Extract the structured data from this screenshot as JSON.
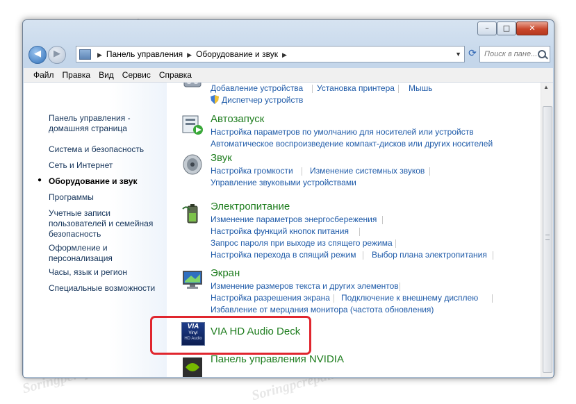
{
  "window": {
    "minimize_glyph": "–",
    "maximize_glyph": "□",
    "close_glyph": "✕"
  },
  "nav": {
    "back_glyph": "◀",
    "forward_glyph": "▶",
    "breadcrumb": [
      "Панель управления",
      "Оборудование и звук"
    ],
    "search_placeholder": "Поиск в пане..."
  },
  "menu": [
    "Файл",
    "Правка",
    "Вид",
    "Сервис",
    "Справка"
  ],
  "sidebar": {
    "items": [
      "Панель управления -",
      "домашняя страница",
      "Система и безопасность",
      "Сеть и Интернет",
      "Оборудование и звук",
      "Программы",
      "Учетные записи",
      "пользователей и семейная",
      "безопасность",
      "Оформление и",
      "персонализация",
      "Часы, язык и регион",
      "Специальные возможности"
    ],
    "current_bullet": "●"
  },
  "sections": {
    "devices": {
      "links": [
        "Добавление устройства",
        "Установка принтера",
        "Мышь",
        "Диспетчер устройств"
      ]
    },
    "autoplay": {
      "title": "Автозапуск",
      "links": [
        "Настройка параметров по умолчанию для носителей или устройств",
        "Автоматическое воспроизведение компакт-дисков или других носителей"
      ]
    },
    "sound": {
      "title": "Звук",
      "links": [
        "Настройка громкости",
        "Изменение системных звуков",
        "Управление звуковыми устройствами"
      ]
    },
    "power": {
      "title": "Электропитание",
      "links": [
        "Изменение параметров энергосбережения",
        "Настройка функций кнопок питания",
        "Запрос пароля при выходе из спящего режима",
        "Настройка перехода в спящий режим",
        "Выбор плана электропитания"
      ]
    },
    "display": {
      "title": "Экран",
      "links": [
        "Изменение размеров текста и других элементов",
        "Настройка разрешения экрана",
        "Подключение к внешнему дисплею",
        "Избавление от мерцания монитора (частота обновления)"
      ]
    },
    "via": {
      "title": "VIA HD Audio Deck",
      "icon_text": [
        "VIA",
        "Vinyl",
        "HD Audio"
      ]
    },
    "nvidia": {
      "title": "Панель управления NVIDIA"
    }
  },
  "watermark": "Soringpcrepair.Com",
  "colors": {
    "link": "#1e5aa8",
    "category_title": "#1e7d1e",
    "highlight": "#e0262e"
  }
}
